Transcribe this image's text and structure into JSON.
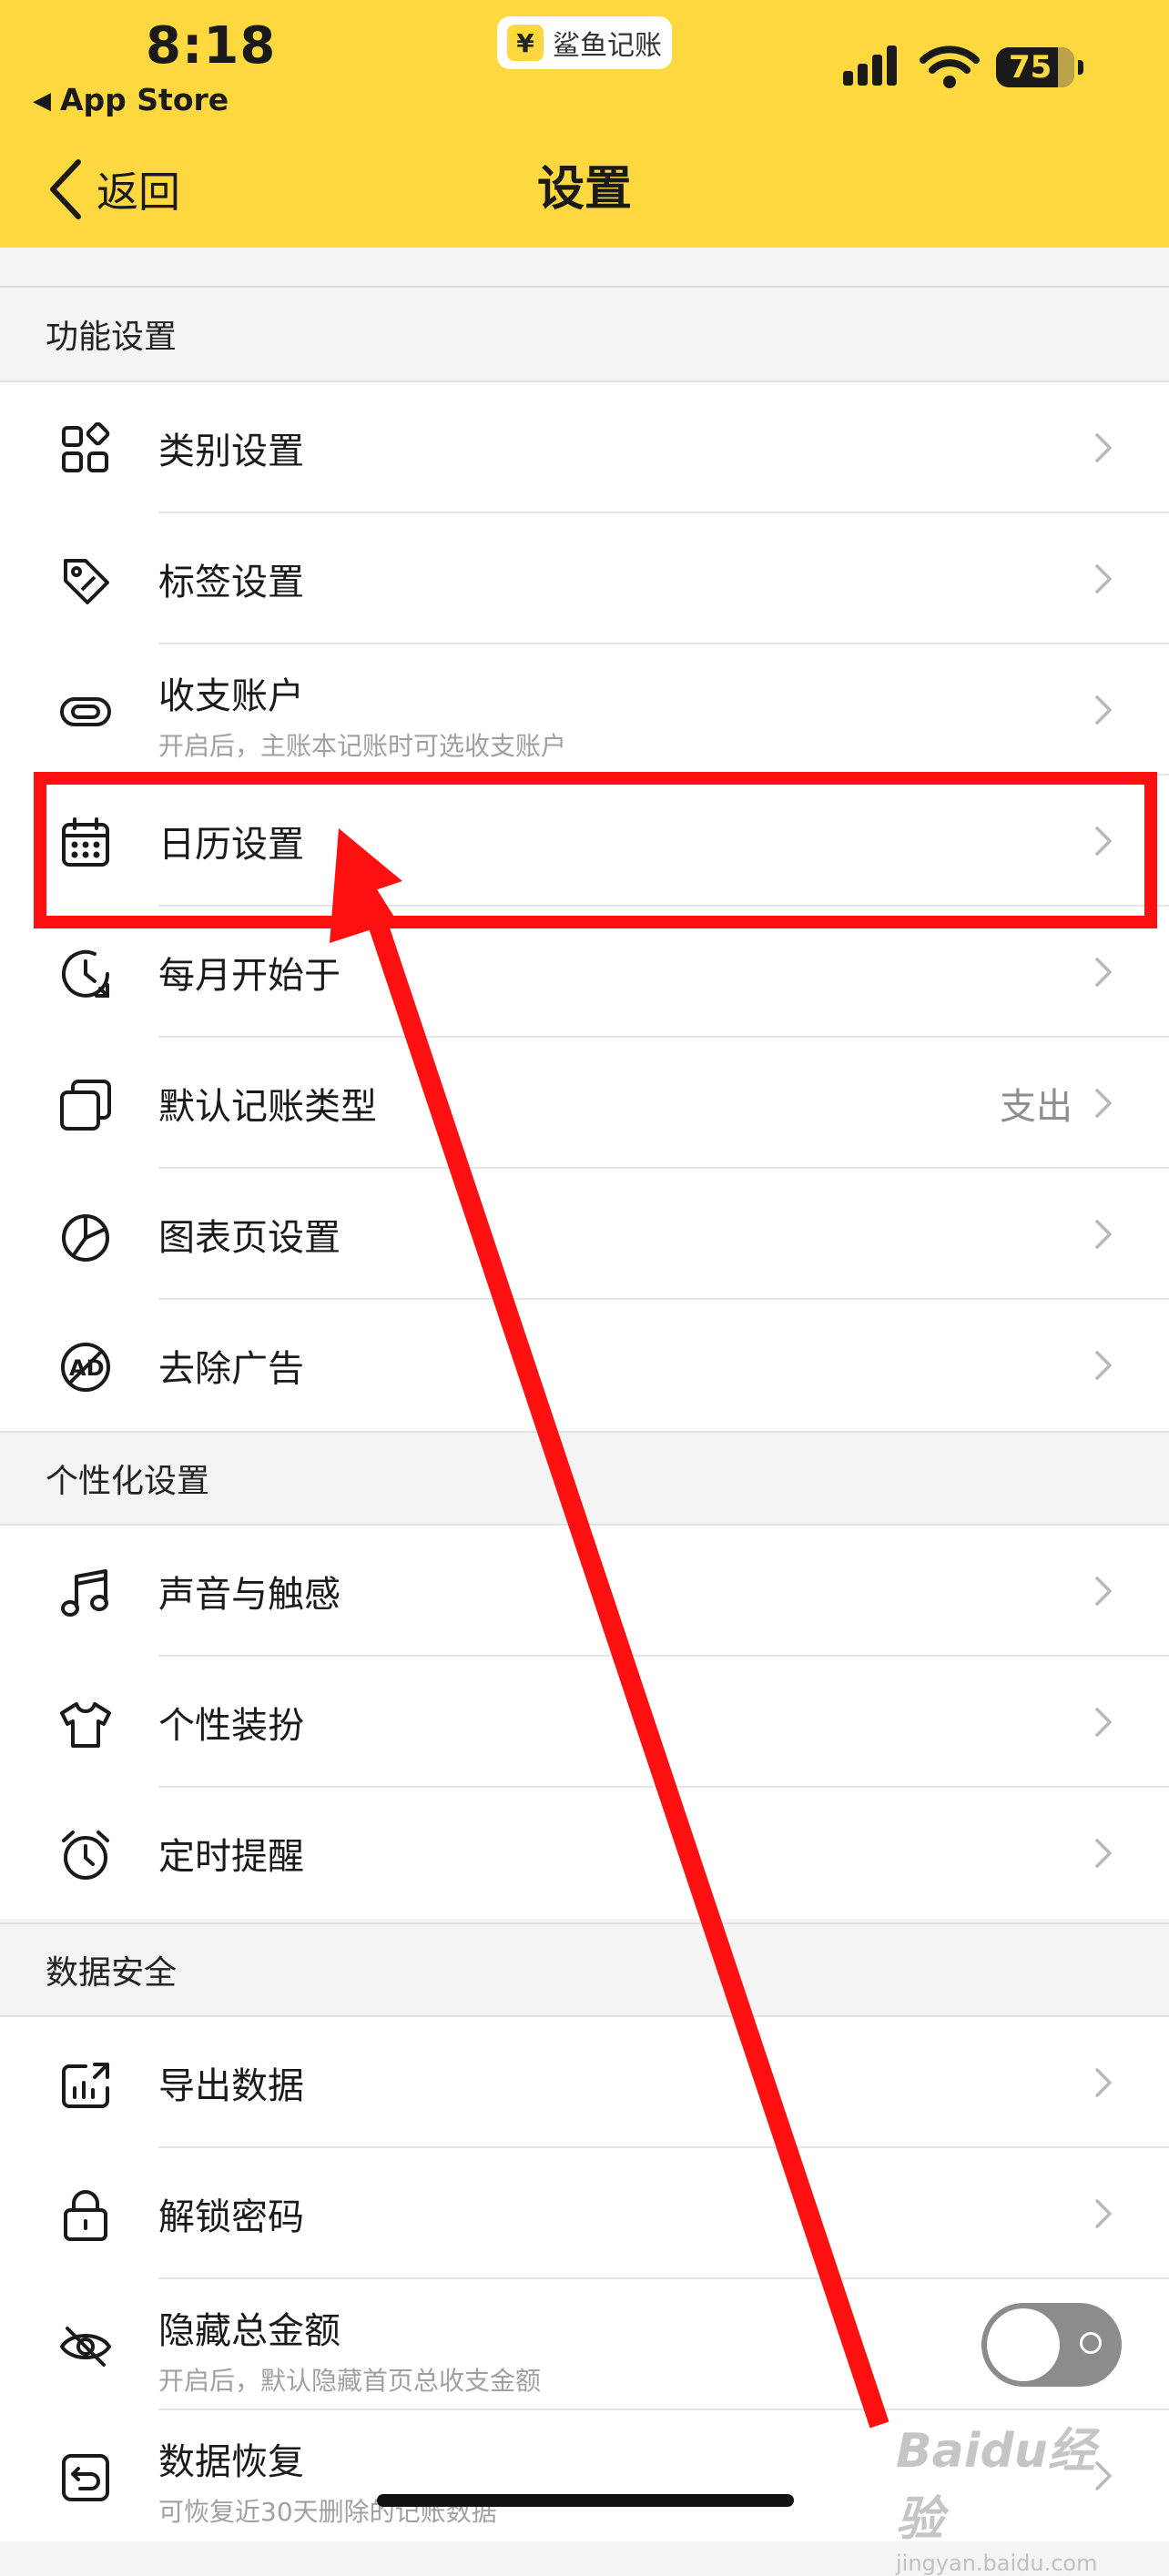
{
  "status_bar": {
    "time": "8:18",
    "back_app": "App Store",
    "app_pill_text": "鲨鱼记账",
    "app_pill_symbol": "¥",
    "battery": "75"
  },
  "nav": {
    "back_label": "返回",
    "title": "设置"
  },
  "sections": [
    {
      "title": "功能设置",
      "items": [
        {
          "label": "类别设置",
          "icon": "category-grid-icon"
        },
        {
          "label": "标签设置",
          "icon": "tag-icon"
        },
        {
          "label": "收支账户",
          "icon": "account-link-icon",
          "subtitle": "开启后，主账本记账时可选收支账户"
        },
        {
          "label": "日历设置",
          "icon": "calendar-icon"
        },
        {
          "label": "每月开始于",
          "icon": "clock-refresh-icon"
        },
        {
          "label": "默认记账类型",
          "icon": "stacked-squares-icon",
          "value": "支出"
        },
        {
          "label": "图表页设置",
          "icon": "pie-chart-icon"
        },
        {
          "label": "去除广告",
          "icon": "no-ads-icon"
        }
      ]
    },
    {
      "title": "个性化设置",
      "items": [
        {
          "label": "声音与触感",
          "icon": "music-note-icon"
        },
        {
          "label": "个性装扮",
          "icon": "tshirt-icon"
        },
        {
          "label": "定时提醒",
          "icon": "alarm-clock-icon"
        }
      ]
    },
    {
      "title": "数据安全",
      "items": [
        {
          "label": "导出数据",
          "icon": "export-chart-icon"
        },
        {
          "label": "解锁密码",
          "icon": "lock-icon"
        },
        {
          "label": "隐藏总金额",
          "icon": "eye-hidden-icon",
          "subtitle": "开启后，默认隐藏首页总收支金额",
          "toggle": false
        },
        {
          "label": "数据恢复",
          "icon": "restore-icon",
          "subtitle": "可恢复近30天删除的记账数据"
        }
      ]
    }
  ],
  "watermark": {
    "brand": "Baidu经验",
    "url": "jingyan.baidu.com"
  },
  "colors": {
    "header_yellow": "#fdd83f",
    "highlight_red": "#ff1010",
    "toggle_off": "#8c8c8c"
  }
}
